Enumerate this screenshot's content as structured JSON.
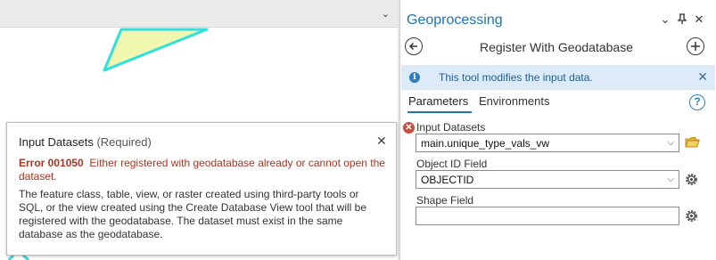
{
  "map": {
    "polygon_fill": "#f0f8b0",
    "polygon_outline": "#2fe0e0"
  },
  "gp_pane": {
    "title": "Geoprocessing",
    "header_buttons": {
      "menu": "⌄",
      "pin": "⊥",
      "close": "✕"
    },
    "tool_title": "Register With Geodatabase",
    "info_bar": {
      "icon": "i",
      "text": "This tool modifies the input data.",
      "close": "✕"
    },
    "tabs": [
      "Parameters",
      "Environments"
    ],
    "help": "?",
    "params": {
      "input_datasets": {
        "label": "Input Datasets",
        "value": "main.unique_type_vals_vw",
        "error_icon": "✕"
      },
      "object_id_field": {
        "label": "Object ID Field",
        "value": "OBJECTID"
      },
      "shape_field": {
        "label": "Shape Field",
        "value": ""
      }
    },
    "dropdown_chevron": "⌵"
  },
  "tooltip": {
    "title": "Input Datasets",
    "required": "(Required)",
    "close": "✕",
    "error_code": "Error 001050",
    "error_message": "Either registered with geodatabase already or cannot open the dataset.",
    "description": "The feature class, table, view, or raster created using third-party tools or SQL, or the view created using the Create Database View tool that will be registered with the geodatabase. The dataset must exist in the same database as the geodatabase."
  },
  "colors": {
    "accent": "#1a75bb",
    "error": "#b0311e",
    "info_bg": "#dcebf7"
  }
}
